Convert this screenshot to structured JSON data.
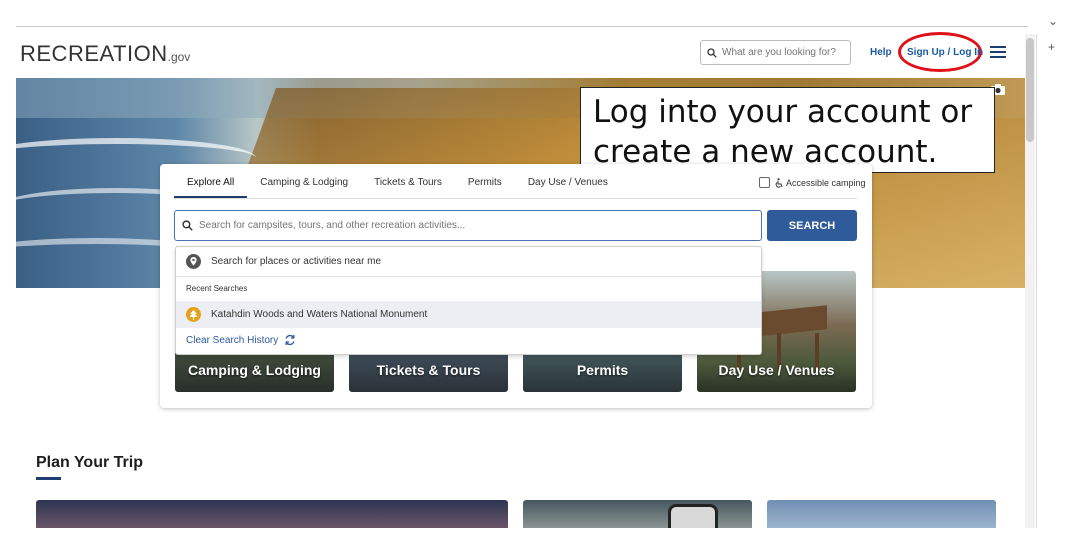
{
  "header": {
    "logo_text": "RECREATION",
    "logo_suffix": ".gov",
    "search_placeholder": "What are you looking for?",
    "help_label": "Help",
    "signin_label": "Sign Up / Log In"
  },
  "callout": {
    "text": "Log into your account or create a new account.",
    "ring_color": "#e0101a"
  },
  "browser": {
    "side_chevron": "⌄",
    "side_plus": "+"
  },
  "explore": {
    "tabs": [
      {
        "label": "Explore All",
        "active": true
      },
      {
        "label": "Camping & Lodging"
      },
      {
        "label": "Tickets & Tours"
      },
      {
        "label": "Permits"
      },
      {
        "label": "Day Use / Venues"
      }
    ],
    "accessible_label": "Accessible camping",
    "search_placeholder": "Search for campsites, tours, and other recreation activities...",
    "search_button": "SEARCH"
  },
  "dropdown": {
    "near_me": "Search for places or activities near me",
    "recent_label": "Recent Searches",
    "recent_items": [
      "Katahdin Woods and Waters National Monument"
    ],
    "clear_label": "Clear Search History"
  },
  "categories": [
    {
      "label": "Camping & Lodging"
    },
    {
      "label": "Tickets & Tours"
    },
    {
      "label": "Permits"
    },
    {
      "label": "Day Use / Venues"
    }
  ],
  "plan": {
    "title": "Plan Your Trip"
  },
  "colors": {
    "brand_blue": "#1f3d70",
    "link_blue": "#1a5aa6",
    "button_blue": "#2f5b9b",
    "recent_icon": "#e3a11f"
  },
  "icons": [
    "search-icon",
    "hamburger-menu-icon",
    "camera-icon",
    "wheelchair-icon",
    "location-pin-icon",
    "tree-icon",
    "refresh-icon"
  ]
}
